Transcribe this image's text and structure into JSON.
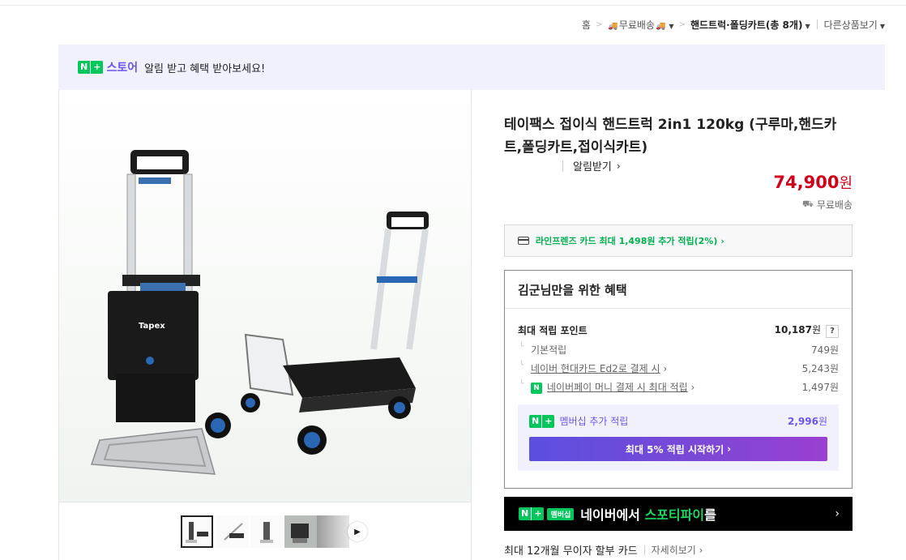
{
  "breadcrumb": {
    "home": "홈",
    "free_shipping": "무료배송",
    "category": "핸드트럭·폴딩카트(총 8개)",
    "more_products": "다른상품보기"
  },
  "banner": {
    "store": "스토어",
    "message": "알림 받고 혜택 받아보세요!",
    "notify": "알림받기"
  },
  "product": {
    "title": "테이팩스 접이식 핸드트럭 2in1 120kg (구루마,핸드카트,폴딩카트,접이식카트)",
    "price": "74,900",
    "price_unit": "원",
    "shipping": "무료배송"
  },
  "card_promo": "라인프렌즈 카드 최대 1,498원 추가 적립(2%)",
  "benefit": {
    "title": "김군님만을 위한 혜택",
    "max_points_label": "최대 적립 포인트",
    "max_points_value": "10,187",
    "won": "원",
    "help": "?",
    "rows": [
      {
        "label": "기본적립",
        "value": "749원"
      },
      {
        "label": "네이버 현대카드 Ed2로 결제 시",
        "value": "5,243원"
      },
      {
        "label": "네이버페이 머니 결제 시 최대 적립",
        "value": "1,497원"
      }
    ],
    "npay_icon": "N",
    "membership_label": "멤버십 추가 적립",
    "membership_value": "2,996",
    "membership_button": "최대 5% 적립 시작하기"
  },
  "spotify": {
    "tag": "멤버십",
    "text_pre": "네이버에서 ",
    "text_accent": "스포티파이",
    "text_post": "를"
  },
  "installment": {
    "text": "최대 12개월 무이자 할부 카드",
    "more": "자세히보기"
  },
  "colors": {
    "naver_green": "#03c75a",
    "price_red": "#d0021b",
    "purple": "#6b56e8",
    "link_blue": "#2b6de8"
  }
}
